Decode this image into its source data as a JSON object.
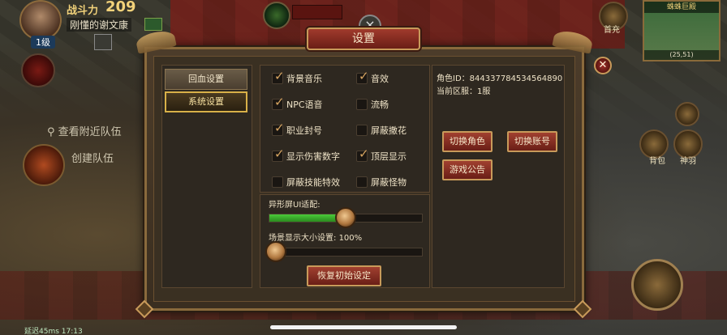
{
  "hud": {
    "power_label": "战斗力",
    "power_value": "209",
    "player_name": "刚懂的谢文康",
    "level": "1级",
    "recharge_label": "首充",
    "right_icon_a_label": "背包",
    "right_icon_b_label": "神羽",
    "minimap_title": "蛛蛛巨殿",
    "minimap_coord": "(25,51)",
    "search_team": "查看附近队伍",
    "create_team": "创建队伍",
    "status_text": "延迟45ms 17:13"
  },
  "dialog": {
    "title": "设置",
    "tabs": [
      {
        "label": "回血设置",
        "active": false
      },
      {
        "label": "系统设置",
        "active": true
      }
    ],
    "options": [
      {
        "label": "背景音乐",
        "checked": true
      },
      {
        "label": "音效",
        "checked": true
      },
      {
        "label": "NPC语音",
        "checked": true
      },
      {
        "label": "流畅",
        "checked": false
      },
      {
        "label": "职业封号",
        "checked": true
      },
      {
        "label": "屏蔽撒花",
        "checked": false
      },
      {
        "label": "显示伤害数字",
        "checked": true
      },
      {
        "label": "顶层显示",
        "checked": true
      },
      {
        "label": "屏蔽技能特效",
        "checked": false
      },
      {
        "label": "屏蔽怪物",
        "checked": false
      }
    ],
    "sliders": {
      "screen_adapt_label": "异形屏UI适配:",
      "screen_adapt_value": 0.5,
      "scene_scale_label": "场景显示大小设置: ",
      "scene_scale_text": "100%",
      "scene_scale_value": 0.0
    },
    "reset_button": "恢复初始设定",
    "info": {
      "role_id_label": "角色ID：",
      "role_id_value": "844337784534564890",
      "server_label": "当前区服：",
      "server_value": "1服"
    },
    "buttons": {
      "switch_role": "切换角色",
      "switch_account": "切换账号",
      "announcement": "游戏公告"
    },
    "close_glyph": "✕"
  },
  "colors": {
    "accent_gold": "#d8b048",
    "title_red": "#a03a2c",
    "slider_green": "#4aca3a"
  }
}
